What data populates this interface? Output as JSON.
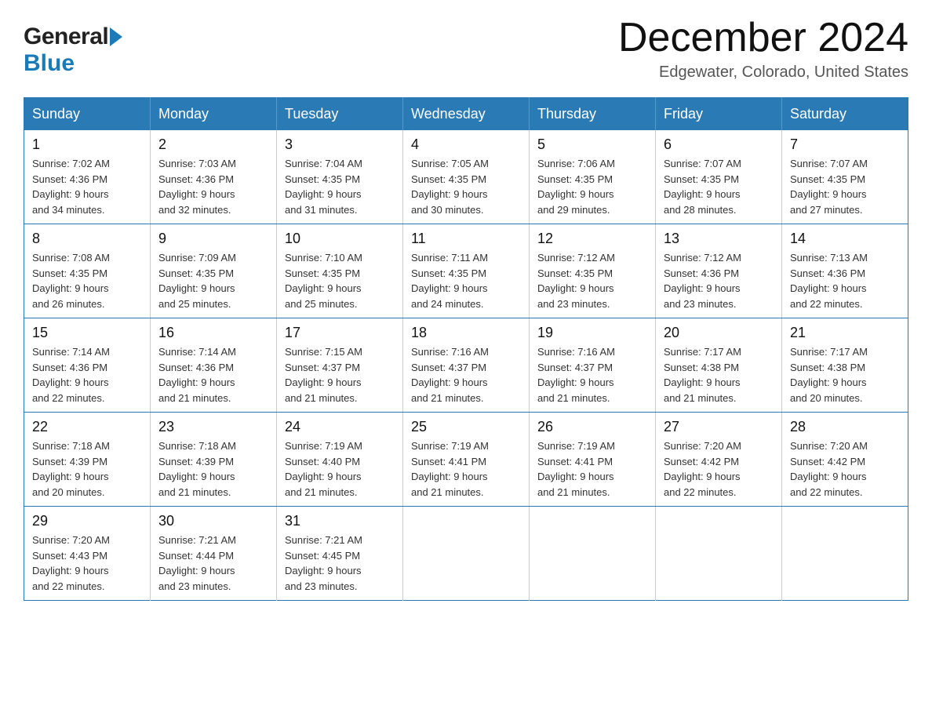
{
  "header": {
    "logo_general": "General",
    "logo_blue": "Blue",
    "month_title": "December 2024",
    "location": "Edgewater, Colorado, United States"
  },
  "weekdays": [
    "Sunday",
    "Monday",
    "Tuesday",
    "Wednesday",
    "Thursday",
    "Friday",
    "Saturday"
  ],
  "weeks": [
    [
      {
        "day": "1",
        "sunrise": "7:02 AM",
        "sunset": "4:36 PM",
        "daylight": "9 hours and 34 minutes."
      },
      {
        "day": "2",
        "sunrise": "7:03 AM",
        "sunset": "4:36 PM",
        "daylight": "9 hours and 32 minutes."
      },
      {
        "day": "3",
        "sunrise": "7:04 AM",
        "sunset": "4:35 PM",
        "daylight": "9 hours and 31 minutes."
      },
      {
        "day": "4",
        "sunrise": "7:05 AM",
        "sunset": "4:35 PM",
        "daylight": "9 hours and 30 minutes."
      },
      {
        "day": "5",
        "sunrise": "7:06 AM",
        "sunset": "4:35 PM",
        "daylight": "9 hours and 29 minutes."
      },
      {
        "day": "6",
        "sunrise": "7:07 AM",
        "sunset": "4:35 PM",
        "daylight": "9 hours and 28 minutes."
      },
      {
        "day": "7",
        "sunrise": "7:07 AM",
        "sunset": "4:35 PM",
        "daylight": "9 hours and 27 minutes."
      }
    ],
    [
      {
        "day": "8",
        "sunrise": "7:08 AM",
        "sunset": "4:35 PM",
        "daylight": "9 hours and 26 minutes."
      },
      {
        "day": "9",
        "sunrise": "7:09 AM",
        "sunset": "4:35 PM",
        "daylight": "9 hours and 25 minutes."
      },
      {
        "day": "10",
        "sunrise": "7:10 AM",
        "sunset": "4:35 PM",
        "daylight": "9 hours and 25 minutes."
      },
      {
        "day": "11",
        "sunrise": "7:11 AM",
        "sunset": "4:35 PM",
        "daylight": "9 hours and 24 minutes."
      },
      {
        "day": "12",
        "sunrise": "7:12 AM",
        "sunset": "4:35 PM",
        "daylight": "9 hours and 23 minutes."
      },
      {
        "day": "13",
        "sunrise": "7:12 AM",
        "sunset": "4:36 PM",
        "daylight": "9 hours and 23 minutes."
      },
      {
        "day": "14",
        "sunrise": "7:13 AM",
        "sunset": "4:36 PM",
        "daylight": "9 hours and 22 minutes."
      }
    ],
    [
      {
        "day": "15",
        "sunrise": "7:14 AM",
        "sunset": "4:36 PM",
        "daylight": "9 hours and 22 minutes."
      },
      {
        "day": "16",
        "sunrise": "7:14 AM",
        "sunset": "4:36 PM",
        "daylight": "9 hours and 21 minutes."
      },
      {
        "day": "17",
        "sunrise": "7:15 AM",
        "sunset": "4:37 PM",
        "daylight": "9 hours and 21 minutes."
      },
      {
        "day": "18",
        "sunrise": "7:16 AM",
        "sunset": "4:37 PM",
        "daylight": "9 hours and 21 minutes."
      },
      {
        "day": "19",
        "sunrise": "7:16 AM",
        "sunset": "4:37 PM",
        "daylight": "9 hours and 21 minutes."
      },
      {
        "day": "20",
        "sunrise": "7:17 AM",
        "sunset": "4:38 PM",
        "daylight": "9 hours and 21 minutes."
      },
      {
        "day": "21",
        "sunrise": "7:17 AM",
        "sunset": "4:38 PM",
        "daylight": "9 hours and 20 minutes."
      }
    ],
    [
      {
        "day": "22",
        "sunrise": "7:18 AM",
        "sunset": "4:39 PM",
        "daylight": "9 hours and 20 minutes."
      },
      {
        "day": "23",
        "sunrise": "7:18 AM",
        "sunset": "4:39 PM",
        "daylight": "9 hours and 21 minutes."
      },
      {
        "day": "24",
        "sunrise": "7:19 AM",
        "sunset": "4:40 PM",
        "daylight": "9 hours and 21 minutes."
      },
      {
        "day": "25",
        "sunrise": "7:19 AM",
        "sunset": "4:41 PM",
        "daylight": "9 hours and 21 minutes."
      },
      {
        "day": "26",
        "sunrise": "7:19 AM",
        "sunset": "4:41 PM",
        "daylight": "9 hours and 21 minutes."
      },
      {
        "day": "27",
        "sunrise": "7:20 AM",
        "sunset": "4:42 PM",
        "daylight": "9 hours and 22 minutes."
      },
      {
        "day": "28",
        "sunrise": "7:20 AM",
        "sunset": "4:42 PM",
        "daylight": "9 hours and 22 minutes."
      }
    ],
    [
      {
        "day": "29",
        "sunrise": "7:20 AM",
        "sunset": "4:43 PM",
        "daylight": "9 hours and 22 minutes."
      },
      {
        "day": "30",
        "sunrise": "7:21 AM",
        "sunset": "4:44 PM",
        "daylight": "9 hours and 23 minutes."
      },
      {
        "day": "31",
        "sunrise": "7:21 AM",
        "sunset": "4:45 PM",
        "daylight": "9 hours and 23 minutes."
      },
      null,
      null,
      null,
      null
    ]
  ],
  "labels": {
    "sunrise_prefix": "Sunrise: ",
    "sunset_prefix": "Sunset: ",
    "daylight_prefix": "Daylight: "
  }
}
